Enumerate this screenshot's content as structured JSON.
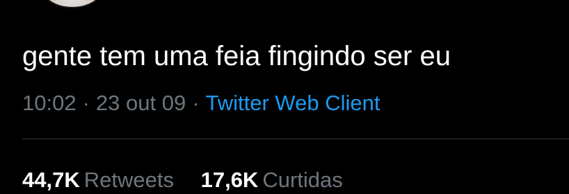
{
  "tweet": {
    "text": "gente tem uma feia fingindo ser eu",
    "time": "10:02",
    "separator": "·",
    "date": "23 out 09",
    "client": "Twitter Web Client"
  },
  "stats": {
    "retweets_count": "44,7K",
    "retweets_label": "Retweets",
    "likes_count": "17,6K",
    "likes_label": "Curtidas"
  },
  "colors": {
    "background": "#000000",
    "text": "#ffffff",
    "muted": "#6e767d",
    "link": "#1d9bf0",
    "divider": "#2f3336"
  }
}
